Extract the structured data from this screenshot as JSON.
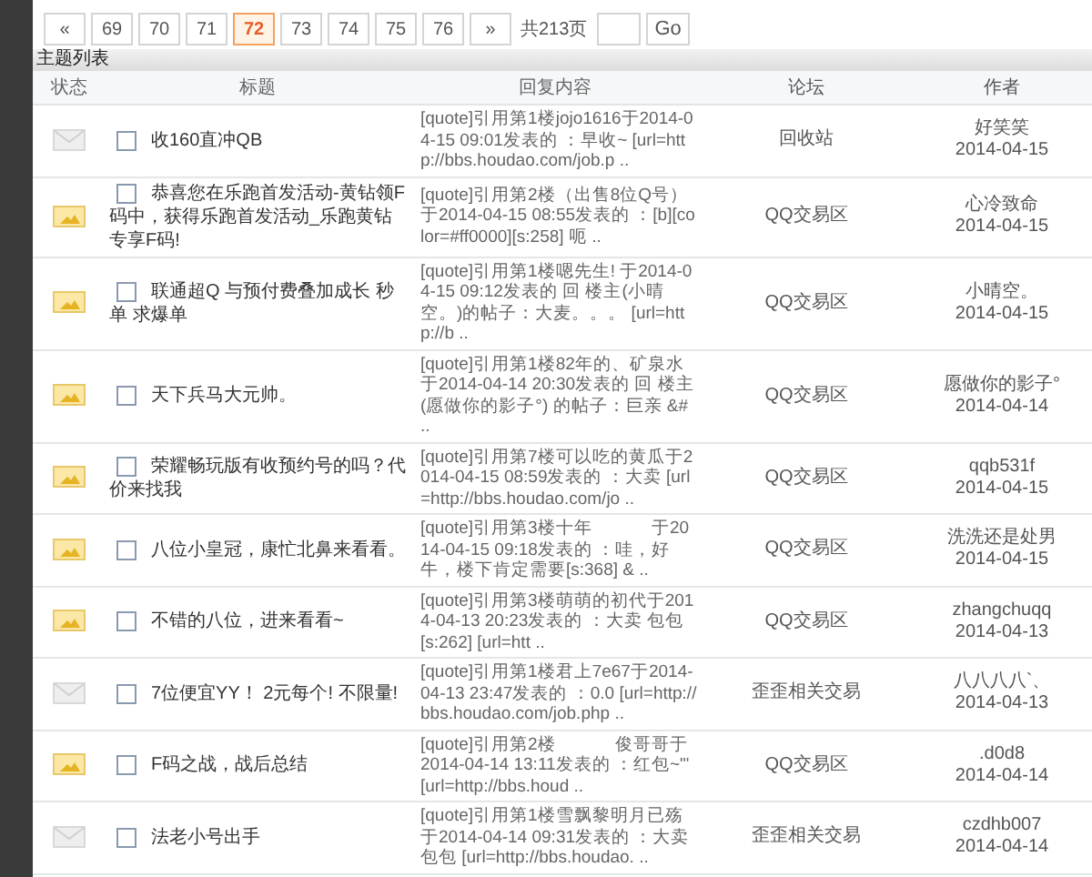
{
  "pagination": {
    "prev": "«",
    "pages": [
      {
        "label": "69",
        "selected": false
      },
      {
        "label": "70",
        "selected": false
      },
      {
        "label": "71",
        "selected": false
      },
      {
        "label": "72",
        "selected": true
      },
      {
        "label": "73",
        "selected": false
      },
      {
        "label": "74",
        "selected": false
      },
      {
        "label": "75",
        "selected": false
      },
      {
        "label": "76",
        "selected": false
      }
    ],
    "next": "»",
    "total": "共213页",
    "go": "Go"
  },
  "section_title": "主题列表",
  "table": {
    "columns": [
      "状态",
      "标题",
      "回复内容",
      "论坛",
      "作者"
    ],
    "rows": [
      {
        "unread": false,
        "checked": false,
        "title": "收160直冲QB",
        "reply": "[quote]引用第1楼jojo1616于2014-04-15 09:01发表的 ：早收~ [url=http://bbs.houdao.com/job.p ..",
        "forum": "回收站",
        "author": "好笑笑",
        "date": "2014-04-15"
      },
      {
        "unread": true,
        "checked": false,
        "title": "恭喜您在乐跑首发活动-黄钻领F码中，获得乐跑首发活动_乐跑黄钻专享F码!",
        "reply": "[quote]引用第2楼（出售8位Q号）于2014-04-15 08:55发表的 ：[b][color=#ff0000][s:258] 呃 ..",
        "forum": "QQ交易区",
        "author": "心冷致命",
        "date": "2014-04-15"
      },
      {
        "unread": true,
        "checked": false,
        "title": "联通超Q 与预付费叠加成长 秒单 求爆单",
        "reply": "[quote]引用第1楼嗯先生! 于2014-04-15 09:12发表的 回 楼主(小晴空。)的帖子：大麦。。。 [url=http://b ..",
        "forum": "QQ交易区",
        "author": "小晴空。",
        "date": "2014-04-15"
      },
      {
        "unread": true,
        "checked": false,
        "title": "天下兵马大元帅。",
        "reply": "[quote]引用第1楼82年的、矿泉水于2014-04-14 20:30发表的 回 楼主(愿做你的影子°) 的帖子：巨亲 &# ..",
        "forum": "QQ交易区",
        "author": "愿做你的影子°",
        "date": "2014-04-14"
      },
      {
        "unread": true,
        "checked": false,
        "title": "荣耀畅玩版有收预约号的吗？代价来找我",
        "reply": "[quote]引用第7楼可以吃的黄瓜于2014-04-15 08:59发表的 ：大卖 [url=http://bbs.houdao.com/jo ..",
        "forum": "QQ交易区",
        "author": "qqb531f",
        "date": "2014-04-15"
      },
      {
        "unread": true,
        "checked": false,
        "title": "八位小皇冠，康忙北鼻来看看。",
        "reply": "[quote]引用第3楼十年　　　 于2014-04-15 09:18发表的 ：哇，好牛，楼下肯定需要[s:368] & ..",
        "forum": "QQ交易区",
        "author": "洗洗还是处男",
        "date": "2014-04-15"
      },
      {
        "unread": true,
        "checked": false,
        "title": "不错的八位，进来看看~",
        "reply": "[quote]引用第3楼萌萌的初代于2014-04-13 20:23发表的 ：大卖 包包[s:262] [url=htt ..",
        "forum": "QQ交易区",
        "author": "zhangchuqq",
        "date": "2014-04-13"
      },
      {
        "unread": false,
        "checked": false,
        "title": "7位便宜YY！ 2元每个! 不限量!",
        "reply": "[quote]引用第1楼君上7e67于2014-04-13 23:47发表的 ：0.0 [url=http://bbs.houdao.com/job.php ..",
        "forum": "歪歪相关交易",
        "author": "八八八八`、",
        "date": "2014-04-13"
      },
      {
        "unread": true,
        "checked": false,
        "title": "F码之战，战后总结",
        "reply": "[quote]引用第2楼　　　 俊哥哥于2014-04-14 13:11发表的 ：红包~\"' [url=http://bbs.houd ..",
        "forum": "QQ交易区",
        "author": ".d0d8",
        "date": "2014-04-14"
      },
      {
        "unread": false,
        "checked": false,
        "title": "法老小号出手",
        "reply": "[quote]引用第1楼雪飘黎明月已殇于2014-04-14 09:31发表的 ：大卖包包 [url=http://bbs.houdao. ..",
        "forum": "歪歪相关交易",
        "author": "czdhb007",
        "date": "2014-04-14"
      }
    ]
  }
}
